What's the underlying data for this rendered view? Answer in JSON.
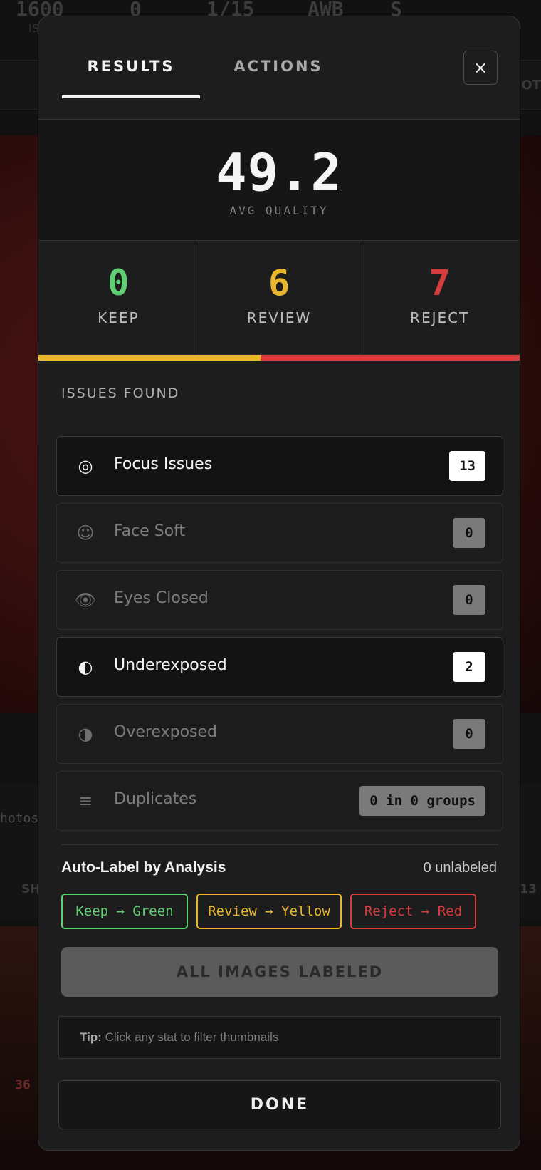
{
  "background": {
    "exif": [
      {
        "value": "1600",
        "sub": "IS"
      },
      {
        "value": "0"
      },
      {
        "value": "1/15"
      },
      {
        "value": "AWB"
      },
      {
        "value": "S"
      }
    ],
    "toolbar_right": "OT",
    "strip_left": "hotos",
    "strip_sh": "SH",
    "strip_count": "13",
    "thumb_number": "36"
  },
  "tabs": [
    {
      "label": "RESULTS",
      "active": true
    },
    {
      "label": "ACTIONS",
      "active": false
    }
  ],
  "close_icon": "×",
  "avg": {
    "value": "49.2",
    "label": "AVG QUALITY"
  },
  "stats": [
    {
      "value": "0",
      "label": "KEEP",
      "color": "#5fcf73"
    },
    {
      "value": "6",
      "label": "REVIEW",
      "color": "#e9b62c"
    },
    {
      "value": "7",
      "label": "REJECT",
      "color": "#d83d3d"
    }
  ],
  "distribution": [
    {
      "name": "keep",
      "count": 0,
      "color": "#5fcf73"
    },
    {
      "name": "review",
      "count": 6,
      "color": "#e9b62c"
    },
    {
      "name": "reject",
      "count": 7,
      "color": "#d83d3d"
    }
  ],
  "issues_title": "ISSUES FOUND",
  "issues": [
    {
      "icon": "◎",
      "icon_name": "target-icon",
      "name": "Focus Issues",
      "count": "13",
      "active": true
    },
    {
      "icon": "☺",
      "icon_name": "smiley-face-icon",
      "name": "Face Soft",
      "count": "0",
      "active": false
    },
    {
      "icon": "👁",
      "icon_name": "eye-icon",
      "name": "Eyes Closed",
      "count": "0",
      "active": false
    },
    {
      "icon": "◐",
      "icon_name": "half-circle-left-icon",
      "name": "Underexposed",
      "count": "2",
      "active": true
    },
    {
      "icon": "◑",
      "icon_name": "half-circle-right-icon",
      "name": "Overexposed",
      "count": "0",
      "active": false
    },
    {
      "icon": "≡",
      "icon_name": "stack-lines-icon",
      "name": "Duplicates",
      "count": "0 in 0 groups",
      "active": false
    }
  ],
  "auto_label": {
    "title": "Auto-Label by Analysis",
    "unlabeled": "0 unlabeled",
    "keep_btn": "Keep → Green",
    "review_btn": "Review → Yellow",
    "reject_btn": "Reject → Red",
    "status_btn": "ALL IMAGES LABELED"
  },
  "tip": {
    "prefix": "Tip:",
    "text": "Click any stat to filter thumbnails"
  },
  "done_label": "DONE"
}
